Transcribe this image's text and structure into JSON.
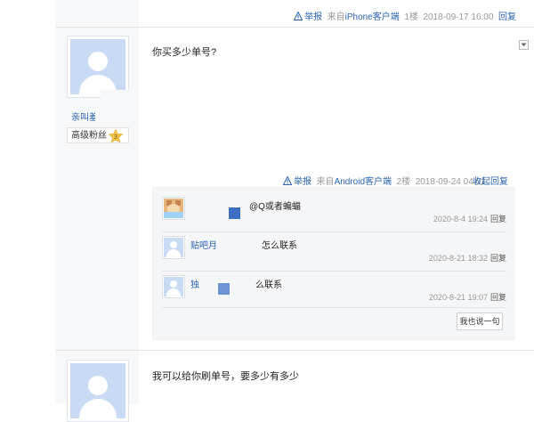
{
  "first_tail": {
    "report": "举报",
    "from_prefix": "来自",
    "client": "iPhone客户端",
    "floor": "1楼",
    "time": "2018-09-17 16:00",
    "reply": "回复"
  },
  "post2": {
    "username": "亲叫羞",
    "fan_title": "高级粉丝",
    "fan_level": "3",
    "content": "你买多少单号?",
    "tail": {
      "report": "举报",
      "from_prefix": "来自",
      "client": "Android客户端",
      "floor": "2楼",
      "time": "2018-09-24 04:01",
      "fold_reply": "收起回复"
    },
    "replies": [
      {
        "name": "",
        "text": "@Q或者蝙蝠",
        "time": "2020-8-4 19:24",
        "reply": "回复"
      },
      {
        "name": "贴吧月",
        "text": "怎么联系",
        "time": "2020-8-21 18:32",
        "reply": "回复"
      },
      {
        "name": "独",
        "text": "么联系",
        "time": "2020-8-21 19:07",
        "reply": "回复"
      }
    ],
    "say_button": "我也说一句"
  },
  "post3": {
    "content": "我可以给你刷单号，要多少有多少"
  },
  "colors": {
    "link_blue": "#2d64b3",
    "meta_gray": "#999999",
    "avatar_bg": "#c9daf5"
  },
  "icons": [
    "warning-icon",
    "collapse-arrow-icon",
    "fan-level-icon"
  ]
}
